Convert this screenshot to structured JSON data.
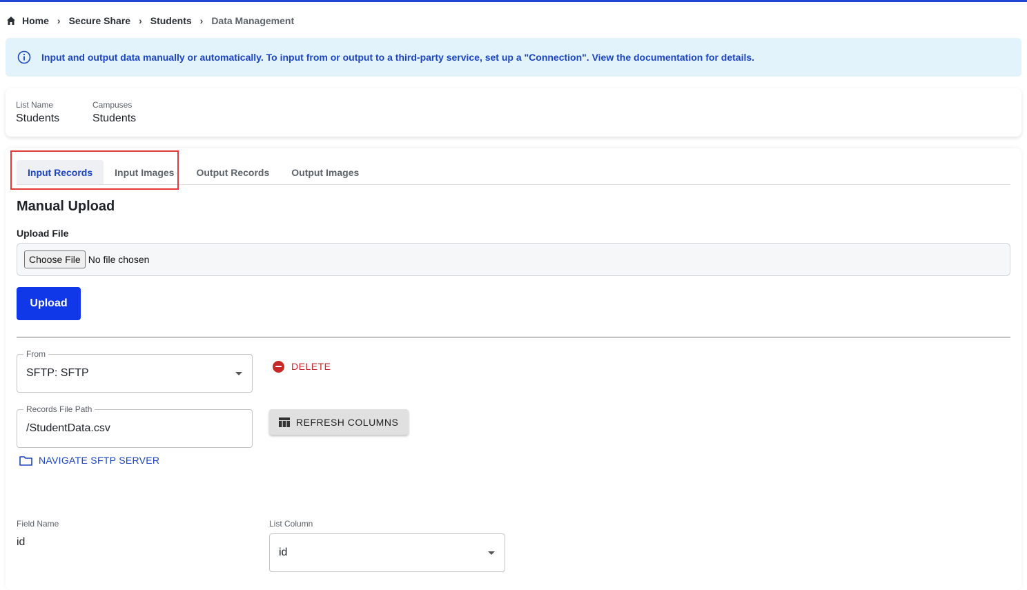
{
  "breadcrumb": {
    "items": [
      "Home",
      "Secure Share",
      "Students"
    ],
    "current": "Data Management"
  },
  "banner": {
    "text": "Input and output data manually or automatically. To input from or output to a third-party service, set up a \"Connection\". View the documentation for details."
  },
  "list_info": {
    "list_name_label": "List Name",
    "list_name_value": "Students",
    "campuses_label": "Campuses",
    "campuses_value": "Students"
  },
  "tabs": [
    {
      "label": "Input Records",
      "active": true
    },
    {
      "label": "Input Images",
      "active": false
    },
    {
      "label": "Output Records",
      "active": false
    },
    {
      "label": "Output Images",
      "active": false
    }
  ],
  "manual_upload": {
    "title": "Manual Upload",
    "field_label": "Upload File",
    "choose_label": "Choose File",
    "file_status": "No file chosen",
    "upload_label": "Upload"
  },
  "connection": {
    "from_label": "From",
    "from_value": "SFTP: SFTP",
    "delete_label": "DELETE",
    "path_label": "Records File Path",
    "path_value": "/StudentData.csv",
    "refresh_label": "REFRESH COLUMNS",
    "navigate_label": "NAVIGATE SFTP SERVER"
  },
  "mapping": {
    "field_name_header": "Field Name",
    "list_column_header": "List Column",
    "rows": [
      {
        "field": "id",
        "column": "id"
      }
    ]
  },
  "colors": {
    "accent": "#1a44c0",
    "primary_button": "#1038e8",
    "danger": "#c62828",
    "banner_bg": "#e3f3fb",
    "highlight": "#e53935"
  },
  "icons": [
    "home-icon",
    "chevron-right-icon",
    "info-icon",
    "minus-circle-icon",
    "table-icon",
    "folder-icon",
    "chevron-down-icon"
  ]
}
